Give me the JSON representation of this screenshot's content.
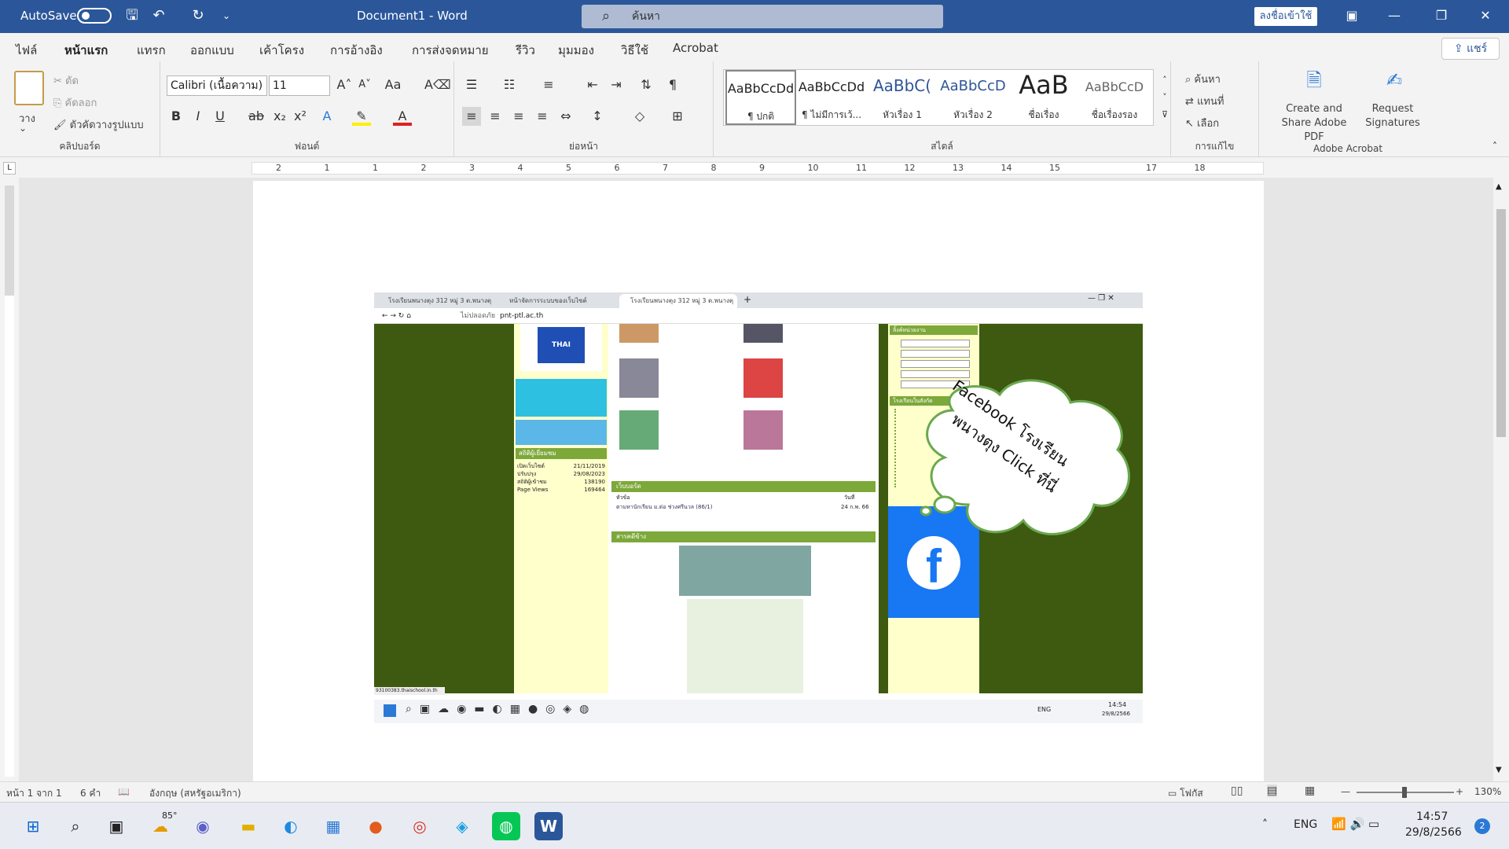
{
  "titlebar": {
    "autosave_label": "AutoSave",
    "doc_title": "Document1 - Word",
    "search_placeholder": "ค้นหา",
    "signin_label": "ลงชื่อเข้าใช้"
  },
  "tabs": [
    "ไฟล์",
    "หน้าแรก",
    "แทรก",
    "ออกแบบ",
    "เค้าโครง",
    "การอ้างอิง",
    "การส่งจดหมาย",
    "รีวิว",
    "มุมมอง",
    "วิธีใช้",
    "Acrobat"
  ],
  "share_label": "แชร์",
  "ribbon": {
    "clipboard": {
      "paste": "วาง",
      "cut": "ตัด",
      "copy": "คัดลอก",
      "format_painter": "ตัวคัดวางรูปแบบ",
      "label": "คลิปบอร์ด"
    },
    "font": {
      "name": "Calibri (เนื้อความ)",
      "size": "11",
      "label": "ฟอนต์"
    },
    "paragraph": {
      "label": "ย่อหน้า"
    },
    "styles": {
      "label": "สไตล์",
      "items": [
        {
          "preview": "AaBbCcDd",
          "name": "¶ ปกติ"
        },
        {
          "preview": "AaBbCcDd",
          "name": "¶ ไม่มีการเว้..."
        },
        {
          "preview": "AaBbC(",
          "name": "หัวเรื่อง 1"
        },
        {
          "preview": "AaBbCcD",
          "name": "หัวเรื่อง 2"
        },
        {
          "preview": "AaB",
          "name": "ชื่อเรื่อง"
        },
        {
          "preview": "AaBbCcD",
          "name": "ชื่อเรื่องรอง"
        }
      ]
    },
    "editing": {
      "find": "ค้นหา",
      "replace": "แทนที่",
      "select": "เลือก",
      "label": "การแก้ไข"
    },
    "acrobat": {
      "create": "Create and Share Adobe PDF",
      "request": "Request Signatures",
      "label": "Adobe Acrobat"
    }
  },
  "ruler_numbers": [
    "2",
    "1",
    "1",
    "2",
    "3",
    "4",
    "5",
    "6",
    "7",
    "8",
    "9",
    "10",
    "11",
    "12",
    "13",
    "14",
    "15",
    "17",
    "18"
  ],
  "embedded": {
    "browser_tabs": [
      "โรงเรียนพนางตุง 312 หมู่ 3 ต.พนางตุ",
      "หน้าจัดการระบบของเว็บไซต์",
      "โรงเรียนพนางตุง 312 หมู่ 3 ต.พนางตุ"
    ],
    "address": "pnt-ptl.ac.th",
    "not_secure": "ไม่ปลอดภัย",
    "stats": {
      "title": "สถิติผู้เยี่ยมชม",
      "open_label": "เปิดเว็บไซต์",
      "open_value": "21/11/2019",
      "update_label": "ปรับปรุง",
      "update_value": "29/08/2023",
      "visits_label": "สถิติผู้เข้าชม",
      "visits_value": "138190",
      "pv_label": "Page Views",
      "pv_value": "169464"
    },
    "webboard": {
      "title": "เว็บบอร์ด",
      "col1": "หัวข้อ",
      "col2": "วันที่",
      "row_text": "ตามหานักเรียน ม.ต่อ ช่วงศรีนวล (86/1)",
      "row_date": "24 ก.พ. 66"
    },
    "news_title": "สารคดีข้าง",
    "bubble_text_1": "Facebook โรงเรียน",
    "bubble_text_2": "พนางตุง Click ที่นี่",
    "school_links_title": "โรงเรียนในสังกัด",
    "gov_links_title": "ลิ้งค์หน่วยงาน",
    "status_url": "93100383.thaischool.in.th",
    "tray_lang": "ENG",
    "tray_time": "14:54",
    "tray_date": "29/8/2566"
  },
  "statusbar": {
    "page": "หน้า 1 จาก 1",
    "words": "6 คำ",
    "language": "อังกฤษ (สหรัฐอเมริกา)",
    "focus": "โฟกัส",
    "zoom": "130%"
  },
  "taskbar": {
    "weather": "85°",
    "lang": "ENG",
    "time": "14:57",
    "date": "29/8/2566",
    "badge": "2"
  },
  "colors": {
    "word_blue": "#2b579a",
    "site_green": "#3d5a10",
    "fb_blue": "#1877f2",
    "bubble_border": "#6aa84f"
  }
}
